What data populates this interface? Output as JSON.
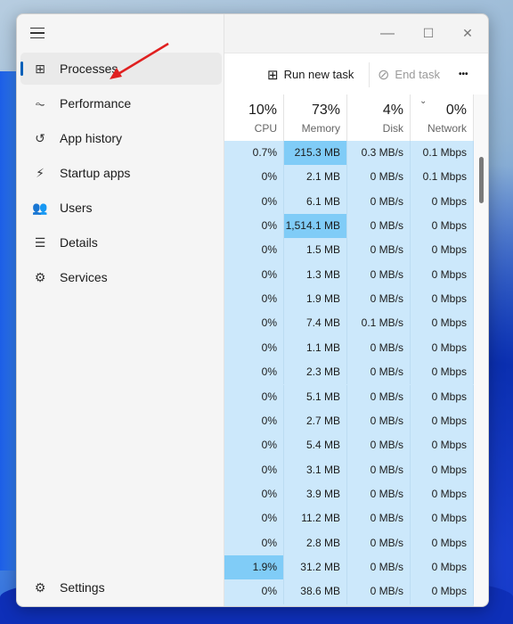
{
  "sidebar": {
    "items": [
      {
        "label": "Processes",
        "icon": "processes-icon",
        "glyph": "⊞",
        "active": true
      },
      {
        "label": "Performance",
        "icon": "performance-icon",
        "glyph": "⏦"
      },
      {
        "label": "App history",
        "icon": "app-history-icon",
        "glyph": "↺"
      },
      {
        "label": "Startup apps",
        "icon": "startup-apps-icon",
        "glyph": "⚡"
      },
      {
        "label": "Users",
        "icon": "users-icon",
        "glyph": "👥"
      },
      {
        "label": "Details",
        "icon": "details-icon",
        "glyph": "☰"
      },
      {
        "label": "Services",
        "icon": "services-icon",
        "glyph": "⚙"
      }
    ],
    "settings": {
      "label": "Settings",
      "icon": "settings-icon",
      "glyph": "⚙"
    }
  },
  "window": {
    "minimize": "—",
    "maximize": "☐",
    "close": "✕"
  },
  "toolbar": {
    "run_new_task": "Run new task",
    "end_task": "End task",
    "more": "•••"
  },
  "columns": [
    {
      "pct": "10%",
      "name": "CPU"
    },
    {
      "pct": "73%",
      "name": "Memory"
    },
    {
      "pct": "4%",
      "name": "Disk"
    },
    {
      "pct": "0%",
      "name": "Network",
      "sorted": "descending"
    }
  ],
  "rows": [
    [
      "0.7%",
      "215.3 MB",
      "0.3 MB/s",
      "0.1 Mbps"
    ],
    [
      "0%",
      "2.1 MB",
      "0 MB/s",
      "0.1 Mbps"
    ],
    [
      "0%",
      "6.1 MB",
      "0 MB/s",
      "0 Mbps"
    ],
    [
      "0%",
      "1,514.1 MB",
      "0 MB/s",
      "0 Mbps"
    ],
    [
      "0%",
      "1.5 MB",
      "0 MB/s",
      "0 Mbps"
    ],
    [
      "0%",
      "1.3 MB",
      "0 MB/s",
      "0 Mbps"
    ],
    [
      "0%",
      "1.9 MB",
      "0 MB/s",
      "0 Mbps"
    ],
    [
      "0%",
      "7.4 MB",
      "0.1 MB/s",
      "0 Mbps"
    ],
    [
      "0%",
      "1.1 MB",
      "0 MB/s",
      "0 Mbps"
    ],
    [
      "0%",
      "2.3 MB",
      "0 MB/s",
      "0 Mbps"
    ],
    [
      "0%",
      "5.1 MB",
      "0 MB/s",
      "0 Mbps"
    ],
    [
      "0%",
      "2.7 MB",
      "0 MB/s",
      "0 Mbps"
    ],
    [
      "0%",
      "5.4 MB",
      "0 MB/s",
      "0 Mbps"
    ],
    [
      "0%",
      "3.1 MB",
      "0 MB/s",
      "0 Mbps"
    ],
    [
      "0%",
      "3.9 MB",
      "0 MB/s",
      "0 Mbps"
    ],
    [
      "0%",
      "11.2 MB",
      "0 MB/s",
      "0 Mbps"
    ],
    [
      "0%",
      "2.8 MB",
      "0 MB/s",
      "0 Mbps"
    ],
    [
      "1.9%",
      "31.2 MB",
      "0 MB/s",
      "0 Mbps"
    ],
    [
      "0%",
      "38.6 MB",
      "0 MB/s",
      "0 Mbps"
    ]
  ],
  "highlights": [
    [
      0,
      1
    ],
    [
      3,
      1
    ],
    [
      17,
      0
    ]
  ],
  "colors": {
    "row": "#cce8fb",
    "highlight": "#80ccf7",
    "accent": "#005fb8",
    "annotation_arrow": "#e02020"
  }
}
